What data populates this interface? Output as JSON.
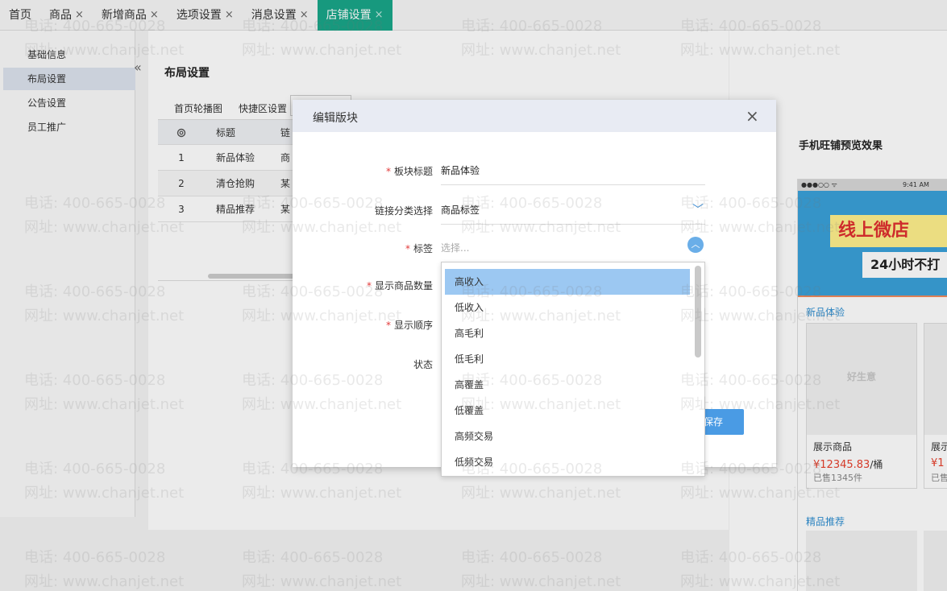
{
  "tabs": [
    {
      "label": "首页",
      "closable": false
    },
    {
      "label": "商品",
      "closable": true
    },
    {
      "label": "新增商品",
      "closable": true
    },
    {
      "label": "选项设置",
      "closable": true
    },
    {
      "label": "消息设置",
      "closable": true
    },
    {
      "label": "店铺设置",
      "closable": true,
      "active": true
    }
  ],
  "close_symbol": "×",
  "sidebar": {
    "collapse_symbol": "«",
    "items": [
      {
        "label": "基础信息"
      },
      {
        "label": "布局设置",
        "active": true
      },
      {
        "label": "公告设置"
      },
      {
        "label": "员工推广"
      }
    ]
  },
  "content": {
    "title": "布局设置",
    "subtabs": [
      "首页轮播图",
      "快捷区设置"
    ],
    "table": {
      "headers": [
        "标题",
        "链"
      ],
      "rows": [
        {
          "index": "1",
          "title": "新品体验",
          "link": "商"
        },
        {
          "index": "2",
          "title": "清仓抢购",
          "link": "某"
        },
        {
          "index": "3",
          "title": "精品推荐",
          "link": "某"
        }
      ]
    }
  },
  "preview": {
    "title": "手机旺铺预览效果",
    "status_signal": "●●●○○ ᯤ",
    "status_time": "9:41 AM",
    "banner_line1": "线上微店",
    "banner_line2": "24小时不打",
    "section1": "新品体验",
    "product_name": "展示商品",
    "product_name2": "展示",
    "price": "¥12345.83",
    "price_unit": "/桶",
    "price2": "¥1",
    "sold": "已售1345件",
    "sold2": "已售",
    "section2": "精品推荐",
    "logo_text": "好生意"
  },
  "modal": {
    "title": "编辑版块",
    "close_symbol": "×",
    "fields": [
      {
        "label": "板块标题",
        "required": true,
        "value": "新品体验"
      },
      {
        "label": "链接分类选择",
        "required": false,
        "value": "商品标签"
      },
      {
        "label": "标签",
        "required": true,
        "placeholder": "选择..."
      },
      {
        "label": "显示商品数量",
        "required": true
      },
      {
        "label": "显示顺序",
        "required": true
      },
      {
        "label": "状态",
        "required": false
      }
    ],
    "required_mark": "*",
    "save_label": "保存"
  },
  "dropdown": {
    "options": [
      "高收入",
      "低收入",
      "高毛利",
      "低毛利",
      "高覆盖",
      "低覆盖",
      "高频交易",
      "低频交易"
    ],
    "selected_index": 0
  },
  "watermark": {
    "phone": "电话: 400-665-0028",
    "site": "网址: www.chanjet.net"
  },
  "colors": {
    "active_tab": "#1aa689",
    "primary": "#4a9be4",
    "required": "#e23b3b",
    "price": "#e8412d",
    "selected_option": "#9cc8f2"
  }
}
